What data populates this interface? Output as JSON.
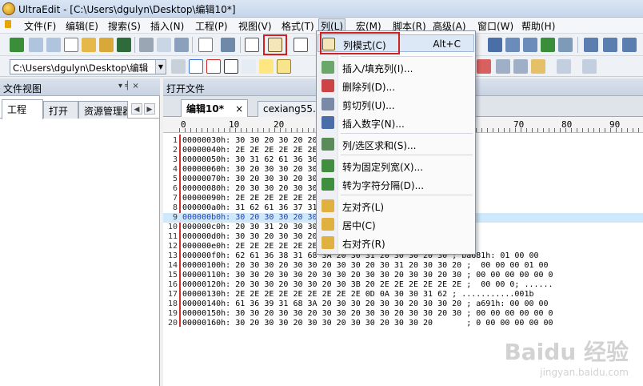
{
  "window": {
    "title": "UltraEdit - [C:\\Users\\dgulyn\\Desktop\\编辑10*]"
  },
  "menubar": [
    {
      "label": "文件(F)"
    },
    {
      "label": "编辑(E)"
    },
    {
      "label": "搜索(S)"
    },
    {
      "label": "插入(N)"
    },
    {
      "label": "工程(P)"
    },
    {
      "label": "视图(V)"
    },
    {
      "label": "格式(T)"
    },
    {
      "label": "列(L)"
    },
    {
      "label": "宏(M)"
    },
    {
      "label": "脚本(R)"
    },
    {
      "label": "高级(A)"
    },
    {
      "label": "窗口(W)"
    },
    {
      "label": "帮助(H)"
    }
  ],
  "toolbar": {
    "path_combo": "C:\\Users\\dgulyn\\Desktop\\编辑"
  },
  "left_panel": {
    "title": "文件视图",
    "pin": "▾ ╡ ×",
    "tabs": [
      {
        "label": "工程"
      },
      {
        "label": "打开"
      },
      {
        "label": "资源管理器"
      }
    ],
    "nav": [
      "◀",
      "▶"
    ]
  },
  "editor": {
    "header": "打开文件",
    "tabs": [
      {
        "label": "编辑10*",
        "close": "×"
      },
      {
        "label": "cexiang55.r"
      }
    ],
    "ruler": {
      "labels": [
        "0",
        "10",
        "20",
        "70",
        "80",
        "90"
      ]
    },
    "lines": [
      {
        "n": "1",
        "text": "00000030h: 30 30 20 30 20 20 ...  00 00 00 ; ..",
        "sel": false
      },
      {
        "n": "2",
        "text": "00000040h: 2E 2E 2E 2E 2E 2E ...  ...........0",
        "sel": false
      },
      {
        "n": "3",
        "text": "00000050h: 30 31 62 61 36 36 ...  01ba661h: 01 00",
        "sel": false
      },
      {
        "n": "4",
        "text": "00000060h: 30 20 30 30 20 30 ...  00 00 00 01 00 0",
        "sel": false
      },
      {
        "n": "5",
        "text": "00000070h: 30 20 30 30 20 30 ...  00 00 00 00 00 0",
        "sel": false
      },
      {
        "n": "6",
        "text": "00000080h: 20 30 30 20 30 30 ...  00 00 00 ; .....",
        "sel": false
      },
      {
        "n": "7",
        "text": "00000090h: 2E 2E 2E 2E 2E 2E ...  ..........00",
        "sel": false
      },
      {
        "n": "8",
        "text": "000000a0h: 31 62 61 36 37 31 ...  1ba671h: 03 00 0",
        "sel": false
      },
      {
        "n": "9",
        "text": "000000b0h: 30 20 30 30 20 30 ...  00 00 00 00 00 00",
        "sel": true
      },
      {
        "n": "10",
        "text": "000000c0h: 20 30 31 20 30 30 ...  01 00 00 00 00 00",
        "sel": false
      },
      {
        "n": "11",
        "text": "000000d0h: 30 30 20 30 30 20 ...  00 00 ; .....",
        "sel": false
      },
      {
        "n": "12",
        "text": "000000e0h: 2E 2E 2E 2E 2E 2E ...  ............001",
        "sel": false
      },
      {
        "n": "13",
        "text": "000000f0h: 62 61 36 38 31 68 3A 20 30 31 20 30 30 20 30 ; ba681h: 01 00 00",
        "sel": false
      },
      {
        "n": "14",
        "text": "00000100h: 20 30 30 20 30 30 20 30 30 20 30 31 20 30 30 20 ;  00 00 00 01 00",
        "sel": false
      },
      {
        "n": "15",
        "text": "00000110h: 30 30 20 30 30 20 30 30 20 30 30 20 30 30 20 30 ; 00 00 00 00 00 0",
        "sel": false
      },
      {
        "n": "16",
        "text": "00000120h: 20 30 30 20 30 30 20 30 3B 20 2E 2E 2E 2E 2E 2E ;  00 00 0; ......",
        "sel": false
      },
      {
        "n": "17",
        "text": "00000130h: 2E 2E 2E 2E 2E 2E 2E 2E 2E 0D 0A 30 30 31 62 ; ...........001b",
        "sel": false
      },
      {
        "n": "18",
        "text": "00000140h: 61 36 39 31 68 3A 20 30 30 20 30 30 20 30 30 20 ; a691h: 00 00 00",
        "sel": false
      },
      {
        "n": "19",
        "text": "00000150h: 30 30 20 30 30 20 30 30 20 30 30 20 30 30 20 30 ; 00 00 00 00 00 0",
        "sel": false
      },
      {
        "n": "20",
        "text": "00000160h: 30 20 30 30 20 30 30 20 30 30 20 30 30 20       ; 0 00 00 00 00 00",
        "sel": false
      }
    ]
  },
  "column_menu": {
    "items": [
      {
        "label": "列模式(C)",
        "shortcut": "Alt+C",
        "icon": "column-mode-icon"
      },
      {
        "label": "插入/填充列(I)...",
        "shortcut": "",
        "icon": "insert-column-icon"
      },
      {
        "label": "删除列(D)...",
        "shortcut": "",
        "icon": "delete-column-icon"
      },
      {
        "label": "剪切列(U)...",
        "shortcut": "",
        "icon": "cut-column-icon"
      },
      {
        "label": "插入数字(N)...",
        "shortcut": "",
        "icon": "insert-number-icon"
      },
      {
        "label": "列/选区求和(S)...",
        "shortcut": "",
        "icon": "sum-icon"
      },
      {
        "label": "转为固定列宽(X)...",
        "shortcut": "",
        "icon": "fixed-width-icon"
      },
      {
        "label": "转为字符分隔(D)...",
        "shortcut": "",
        "icon": "char-delimited-icon"
      },
      {
        "label": "左对齐(L)",
        "shortcut": "",
        "icon": "align-left-icon"
      },
      {
        "label": "居中(C)",
        "shortcut": "",
        "icon": "align-center-icon"
      },
      {
        "label": "右对齐(R)",
        "shortcut": "",
        "icon": "align-right-icon"
      }
    ]
  },
  "watermark": {
    "main": "Baidu 经验",
    "sub": "jingyan.baidu.com"
  },
  "colors": {
    "highlight_box": "#d21f1f",
    "selection": "#cfe8fb",
    "address_blue": "#1a3fc8"
  }
}
